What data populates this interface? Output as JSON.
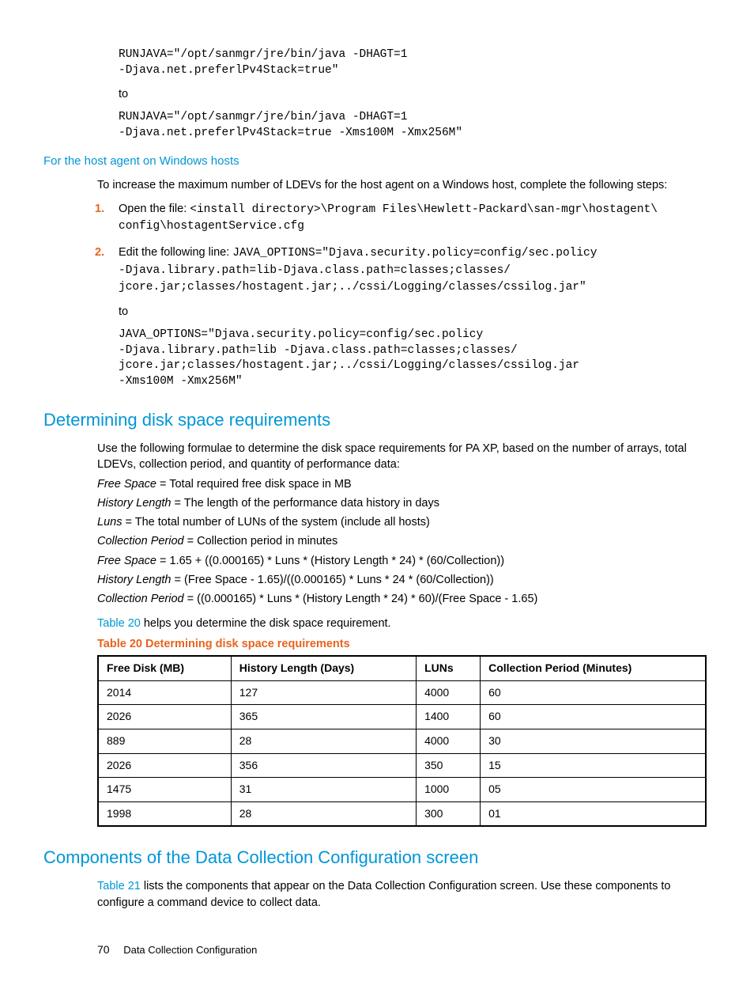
{
  "codeblocks": {
    "block1": "RUNJAVA=\"/opt/sanmgr/jre/bin/java -DHAGT=1\n-Djava.net.preferlPv4Stack=true\"",
    "to1": "to",
    "block2": "RUNJAVA=\"/opt/sanmgr/jre/bin/java -DHAGT=1\n-Djava.net.preferlPv4Stack=true -Xms100M -Xmx256M\""
  },
  "sections": {
    "hostagent_title": "For the host agent on Windows hosts",
    "hostagent_intro": "To increase the maximum number of LDEVs for the host agent on a Windows host, complete the following steps:",
    "step1_lead": "Open the file: ",
    "step1_code": "<install directory>\\Program Files\\Hewlett-Packard\\san-mgr\\hostagent\\ config\\hostagentService.cfg",
    "step2_lead": "Edit the following line: ",
    "step2_code1": "JAVA_OPTIONS=\"Djava.security.policy=config/sec.policy\n-Djava.library.path=lib-Djava.class.path=classes;classes/\njcore.jar;classes/hostagent.jar;../cssi/Logging/classes/cssilog.jar\"",
    "step2_to": "to",
    "step2_code2": "JAVA_OPTIONS=\"Djava.security.policy=config/sec.policy\n-Djava.library.path=lib -Djava.class.path=classes;classes/\njcore.jar;classes/hostagent.jar;../cssi/Logging/classes/cssilog.jar\n-Xms100M -Xmx256M\""
  },
  "disk": {
    "title": "Determining disk space requirements",
    "intro": "Use the following formulae to determine the disk space requirements for PA XP, based on the number of arrays, total LDEVs, collection period, and quantity of performance data:",
    "defs": [
      {
        "term": "Free Space",
        "eq": " = Total required free disk space in MB"
      },
      {
        "term": "History Length",
        "eq": " = The length of the performance data history in days"
      },
      {
        "term": "Luns",
        "eq": " = The total number of LUNs of the system (include all hosts)"
      },
      {
        "term": "Collection Period",
        "eq": " = Collection period in minutes"
      },
      {
        "term": "Free Space",
        "eq": " = 1.65 + ((0.000165) * Luns * (History Length * 24) * (60/Collection))"
      },
      {
        "term": "History Length",
        "eq": " = (Free Space - 1.65)/((0.000165) * Luns * 24 * (60/Collection))"
      },
      {
        "term": "Collection Period",
        "eq": " = ((0.000165) * Luns * (History Length * 24) * 60)/(Free Space - 1.65)"
      }
    ],
    "table_ref_link": "Table 20",
    "table_ref_tail": " helps you determine the disk space requirement.",
    "table_caption": "Table 20 Determining disk space requirements",
    "headers": [
      "Free Disk (MB)",
      "History Length (Days)",
      "LUNs",
      "Collection Period (Minutes)"
    ],
    "rows": [
      [
        "2014",
        "127",
        "4000",
        "60"
      ],
      [
        "2026",
        "365",
        "1400",
        "60"
      ],
      [
        "889",
        "28",
        "4000",
        "30"
      ],
      [
        "2026",
        "356",
        "350",
        "15"
      ],
      [
        "1475",
        "31",
        "1000",
        "05"
      ],
      [
        "1998",
        "28",
        "300",
        "01"
      ]
    ]
  },
  "components": {
    "title": "Components of the Data Collection Configuration screen",
    "ref_link": "Table 21",
    "ref_tail": " lists the components that appear on the Data Collection Configuration screen. Use these components to configure a command device to collect data."
  },
  "footer": {
    "page": "70",
    "label": "Data Collection Configuration"
  },
  "chart_data": {
    "type": "table",
    "title": "Table 20 Determining disk space requirements",
    "columns": [
      "Free Disk (MB)",
      "History Length (Days)",
      "LUNs",
      "Collection Period (Minutes)"
    ],
    "rows": [
      [
        2014,
        127,
        4000,
        60
      ],
      [
        2026,
        365,
        1400,
        60
      ],
      [
        889,
        28,
        4000,
        30
      ],
      [
        2026,
        356,
        350,
        15
      ],
      [
        1475,
        31,
        1000,
        5
      ],
      [
        1998,
        28,
        300,
        1
      ]
    ]
  }
}
